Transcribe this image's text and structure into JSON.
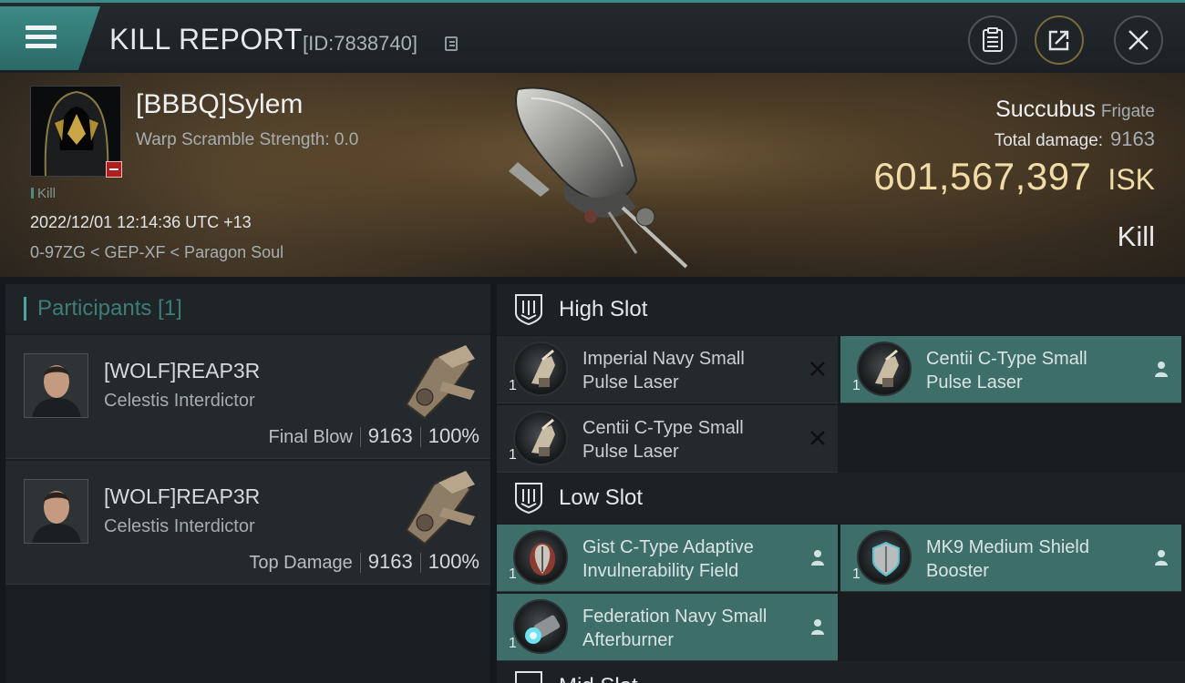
{
  "header": {
    "title": "KILL REPORT",
    "report_id": "[ID:7838740]"
  },
  "victim": {
    "name": "[BBBQ]Sylem",
    "warp_scramble": "Warp Scramble Strength: 0.0",
    "tag": "Kill",
    "datetime": "2022/12/01 12:14:36 UTC +13",
    "location": "0-97ZG < GEP-XF < Paragon Soul"
  },
  "ship": {
    "name": "Succubus",
    "class": "Frigate",
    "total_damage_label": "Total damage:",
    "total_damage": "9163",
    "isk_value": "601,567,397",
    "isk_unit": "ISK",
    "result": "Kill"
  },
  "participants": {
    "header": "Participants [1]",
    "rows": [
      {
        "name": "[WOLF]REAP3R",
        "ship": "Celestis Interdictor",
        "role": "Final Blow",
        "damage": "9163",
        "percent": "100%"
      },
      {
        "name": "[WOLF]REAP3R",
        "ship": "Celestis Interdictor",
        "role": "Top Damage",
        "damage": "9163",
        "percent": "100%"
      }
    ]
  },
  "slots": {
    "high": {
      "title": "High Slot",
      "modules": [
        {
          "name": "Imperial Navy Small Pulse Laser",
          "qty": "1",
          "status": "destroyed"
        },
        {
          "name": "Centii C-Type Small Pulse Laser",
          "qty": "1",
          "status": "dropped"
        },
        {
          "name": "Centii C-Type Small Pulse Laser",
          "qty": "1",
          "status": "destroyed"
        }
      ]
    },
    "low": {
      "title": "Low Slot",
      "modules": [
        {
          "name": "Gist C-Type Adaptive Invulnerability Field",
          "qty": "1",
          "status": "dropped"
        },
        {
          "name": "MK9 Medium Shield Booster",
          "qty": "1",
          "status": "dropped"
        },
        {
          "name": "Federation Navy Small Afterburner",
          "qty": "1",
          "status": "dropped"
        }
      ]
    },
    "mid": {
      "title": "Mid Slot"
    }
  },
  "colors": {
    "accent": "#3d8a86",
    "fitted_row": "#3d6e6a",
    "isk": "#f1dca7",
    "loss_badge": "#b31d1d"
  }
}
